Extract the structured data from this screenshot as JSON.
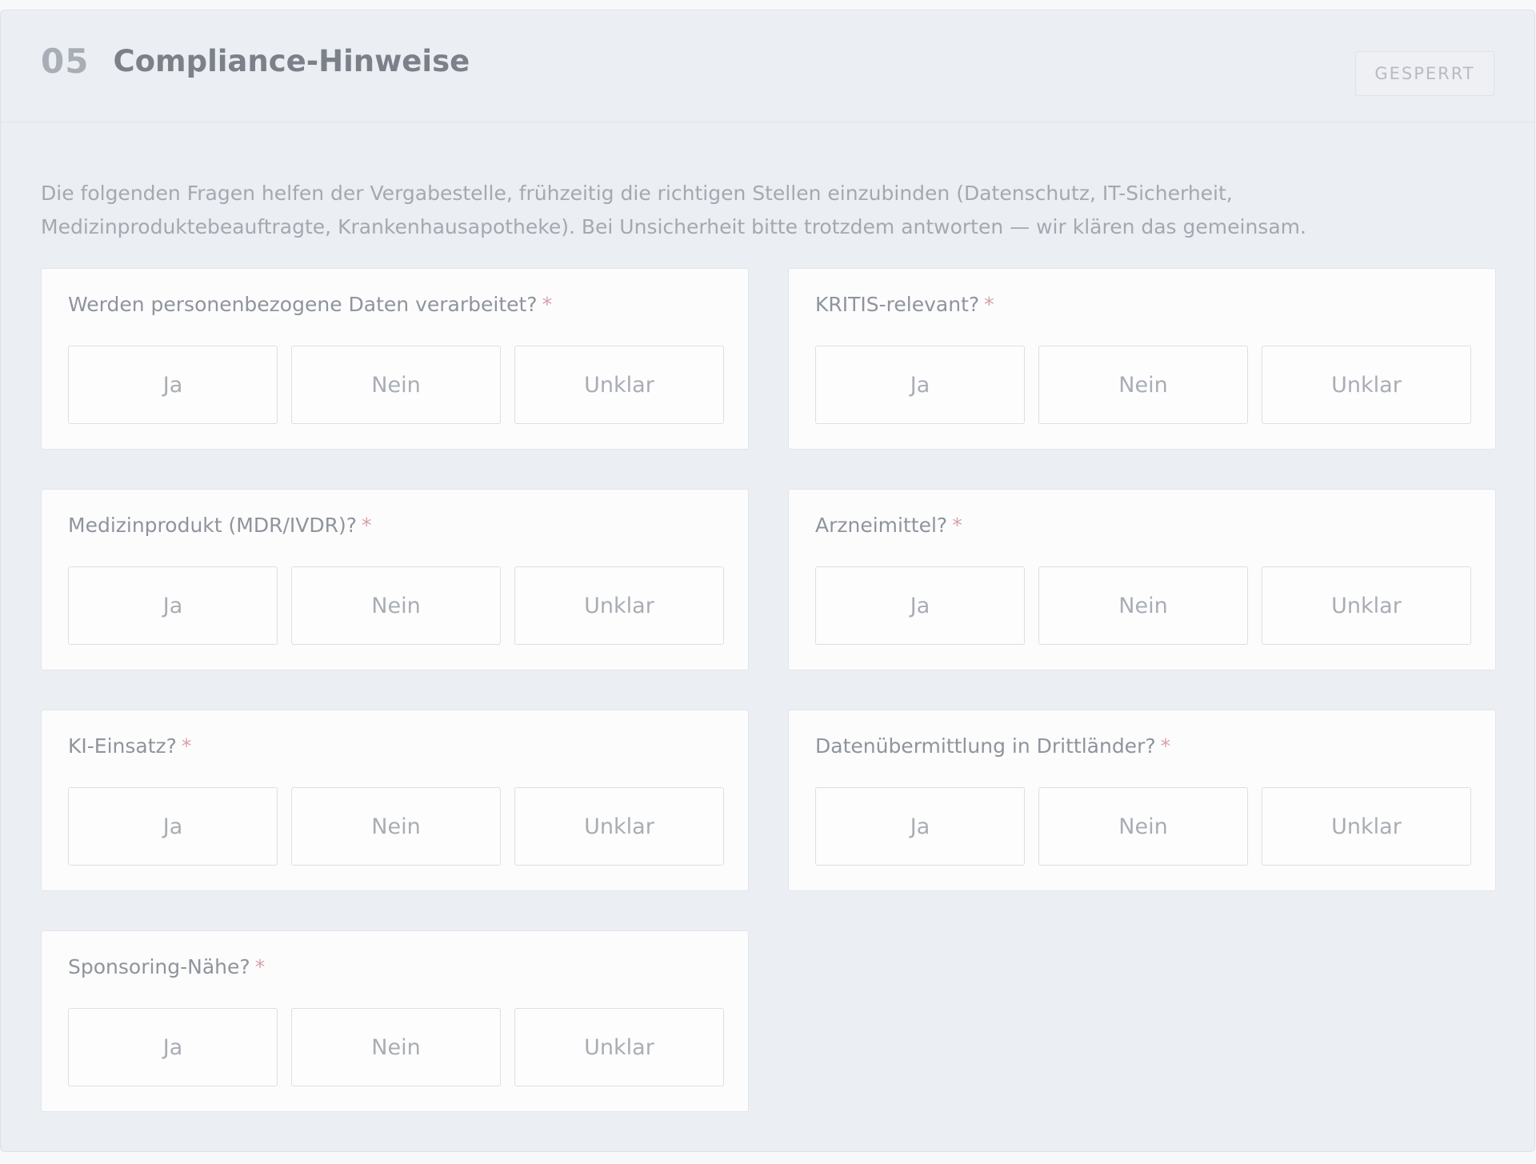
{
  "section": {
    "number": "05",
    "title": "Compliance-Hinweise",
    "status": "GESPERRT",
    "intro": "Die folgenden Fragen helfen der Vergabestelle, frühzeitig die richtigen Stellen einzubinden (Datenschutz, IT-Sicherheit, Medizinproduktebeauftragte, Krankenhausapotheke). Bei Unsicherheit bitte trotzdem antworten — wir klären das gemeinsam."
  },
  "required_marker": "*",
  "options": [
    "Ja",
    "Nein",
    "Unklar"
  ],
  "questions": [
    {
      "label": "Werden personenbezogene Daten verarbeitet?"
    },
    {
      "label": "KRITIS-relevant?"
    },
    {
      "label": "Medizinprodukt (MDR/IVDR)?"
    },
    {
      "label": "Arzneimittel?"
    },
    {
      "label": "KI-Einsatz?"
    },
    {
      "label": "Datenübermittlung in Drittländer?"
    },
    {
      "label": "Sponsoring-Nähe?"
    }
  ],
  "colors": {
    "section_bg": "#ebeef3",
    "card_bg": "#fcfcfd",
    "required": "#d9a0a7",
    "muted_text": "#a4a9b1"
  }
}
